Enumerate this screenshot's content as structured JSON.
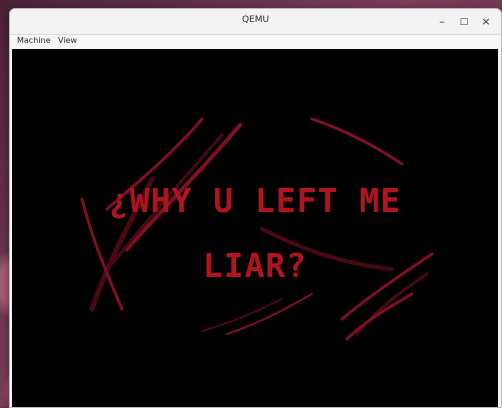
{
  "window": {
    "title": "QEMU",
    "controls": {
      "minimize": "–",
      "maximize": "□",
      "close": "×"
    }
  },
  "menubar": {
    "items": [
      {
        "label": "Machine"
      },
      {
        "label": "View"
      }
    ]
  },
  "screen": {
    "line1": "¿WHY U LEFT ME",
    "line2": "LIAR?",
    "text_color": "#b0141c",
    "scratch_color": "#7e0f24",
    "background": "#000000"
  }
}
